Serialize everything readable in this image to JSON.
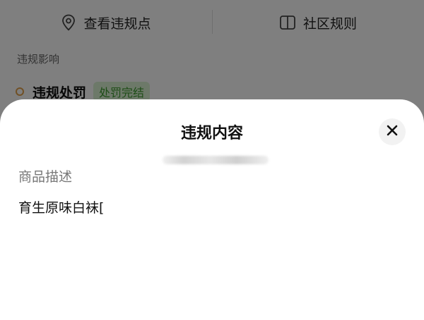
{
  "background": {
    "tabs": [
      {
        "label": "查看违规点",
        "icon": "location-pin-icon"
      },
      {
        "label": "社区规则",
        "icon": "book-icon"
      }
    ],
    "section_label": "违规影响",
    "violation": {
      "title": "违规处罚",
      "status": "处罚完结"
    }
  },
  "sheet": {
    "title": "违规内容",
    "close_icon": "close-icon",
    "field_label": "商品描述",
    "field_value": "育生原味白袜[",
    "colors": {
      "badge_bg": "#daf3d3",
      "badge_text": "#3c9b2e",
      "dot": "#e2a04b"
    }
  }
}
